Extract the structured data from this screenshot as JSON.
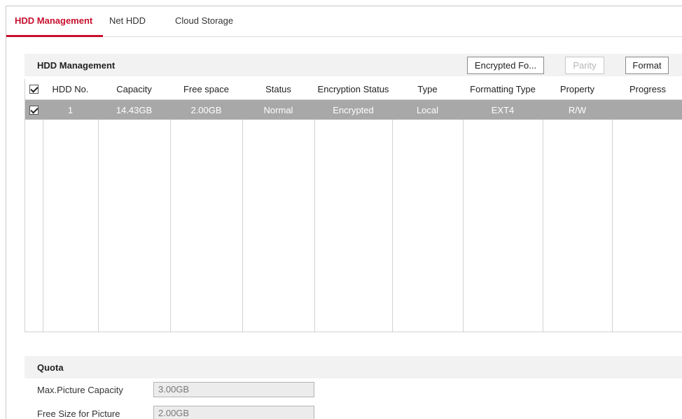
{
  "tabs": [
    {
      "label": "HDD Management",
      "active": true
    },
    {
      "label": "Net HDD",
      "active": false
    },
    {
      "label": "Cloud Storage",
      "active": false
    }
  ],
  "hdd_section": {
    "title": "HDD Management",
    "buttons": {
      "encrypted_format": "Encrypted Fo...",
      "parity": "Parity",
      "format": "Format"
    },
    "columns": [
      "HDD No.",
      "Capacity",
      "Free space",
      "Status",
      "Encryption Status",
      "Type",
      "Formatting Type",
      "Property",
      "Progress"
    ],
    "header_checkbox_checked": true,
    "rows": [
      {
        "checked": true,
        "hdd_no": "1",
        "capacity": "14.43GB",
        "free_space": "2.00GB",
        "status": "Normal",
        "encryption_status": "Encrypted",
        "type": "Local",
        "formatting_type": "EXT4",
        "property": "R/W",
        "progress": ""
      }
    ]
  },
  "quota": {
    "title": "Quota",
    "max_picture_capacity": {
      "label": "Max.Picture Capacity",
      "value": "3.00GB"
    },
    "free_size_for_picture": {
      "label": "Free Size for Picture",
      "value": "2.00GB"
    }
  },
  "colors": {
    "accent": "#c8102e",
    "selected_row": "#a8a8a8",
    "section_header_bg": "#f2f2f2"
  }
}
